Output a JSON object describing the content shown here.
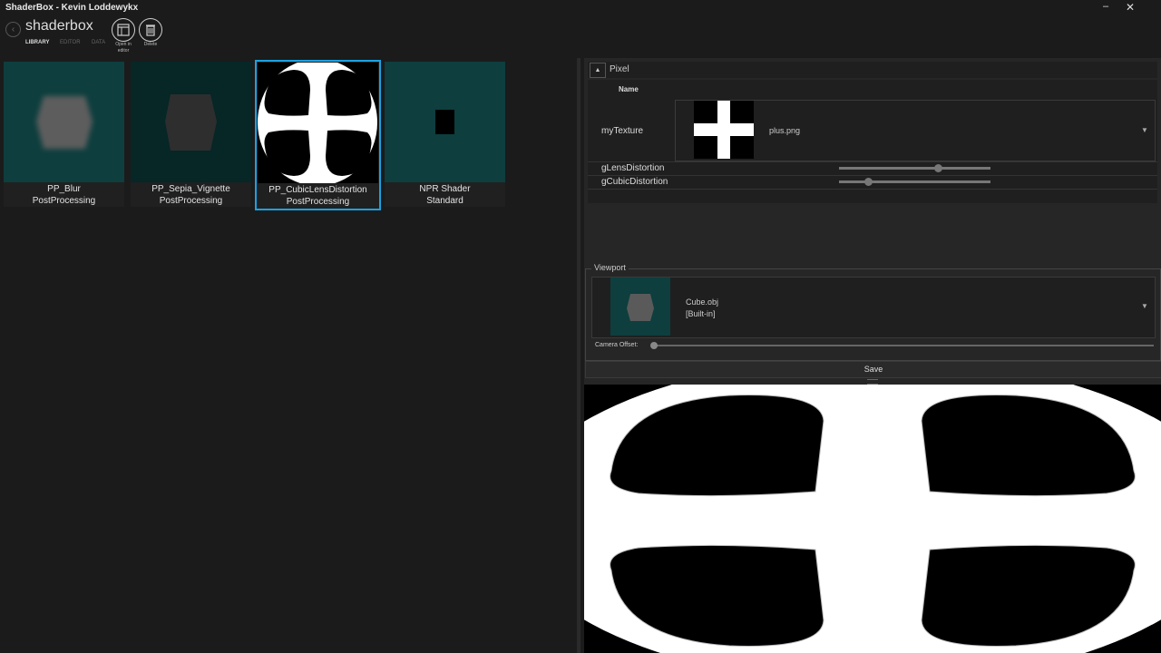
{
  "window": {
    "title": "ShaderBox - Kevin Loddewykx",
    "minimize": "–",
    "close": "✕"
  },
  "header": {
    "back_icon": "‹",
    "brand": "shaderbox",
    "tabs": [
      {
        "label": "LIBRARY"
      },
      {
        "label": "EDITOR"
      },
      {
        "label": "DATA"
      }
    ],
    "tools": [
      {
        "icon": "open-editor-icon",
        "label": "Open in editor"
      },
      {
        "icon": "trash-icon",
        "label": "Delete"
      }
    ]
  },
  "library": {
    "items": [
      {
        "name": "PP_Blur",
        "category": "PostProcessing",
        "thumb_bg": "#0e3e3e"
      },
      {
        "name": "PP_Sepia_Vignette",
        "category": "PostProcessing",
        "thumb_bg": "#072626"
      },
      {
        "name": "PP_CubicLensDistortion",
        "category": "PostProcessing",
        "thumb_bg": "#000000",
        "selected": true
      },
      {
        "name": "NPR Shader",
        "category": "Standard",
        "thumb_bg": "#0e3e3e"
      }
    ]
  },
  "parameters": {
    "collapse_icon": "▲",
    "section": "Pixel",
    "name_header": "Name",
    "texture": {
      "label": "myTexture",
      "file": "plus.png"
    },
    "sliders": [
      {
        "label": "gLensDistortion",
        "value": 0.65
      },
      {
        "label": "gCubicDistortion",
        "value": 0.19
      }
    ]
  },
  "viewport": {
    "legend": "Viewport",
    "model": {
      "name": "Cube.obj",
      "source": "[Built-in]"
    },
    "camera_offset_label": "Camera Offset:",
    "camera_offset": 0.0,
    "dropdown_icon": "▼"
  },
  "save_label": "Save",
  "colors": {
    "accent": "#1ba1e2",
    "teal_bg": "#0e3e3e"
  }
}
